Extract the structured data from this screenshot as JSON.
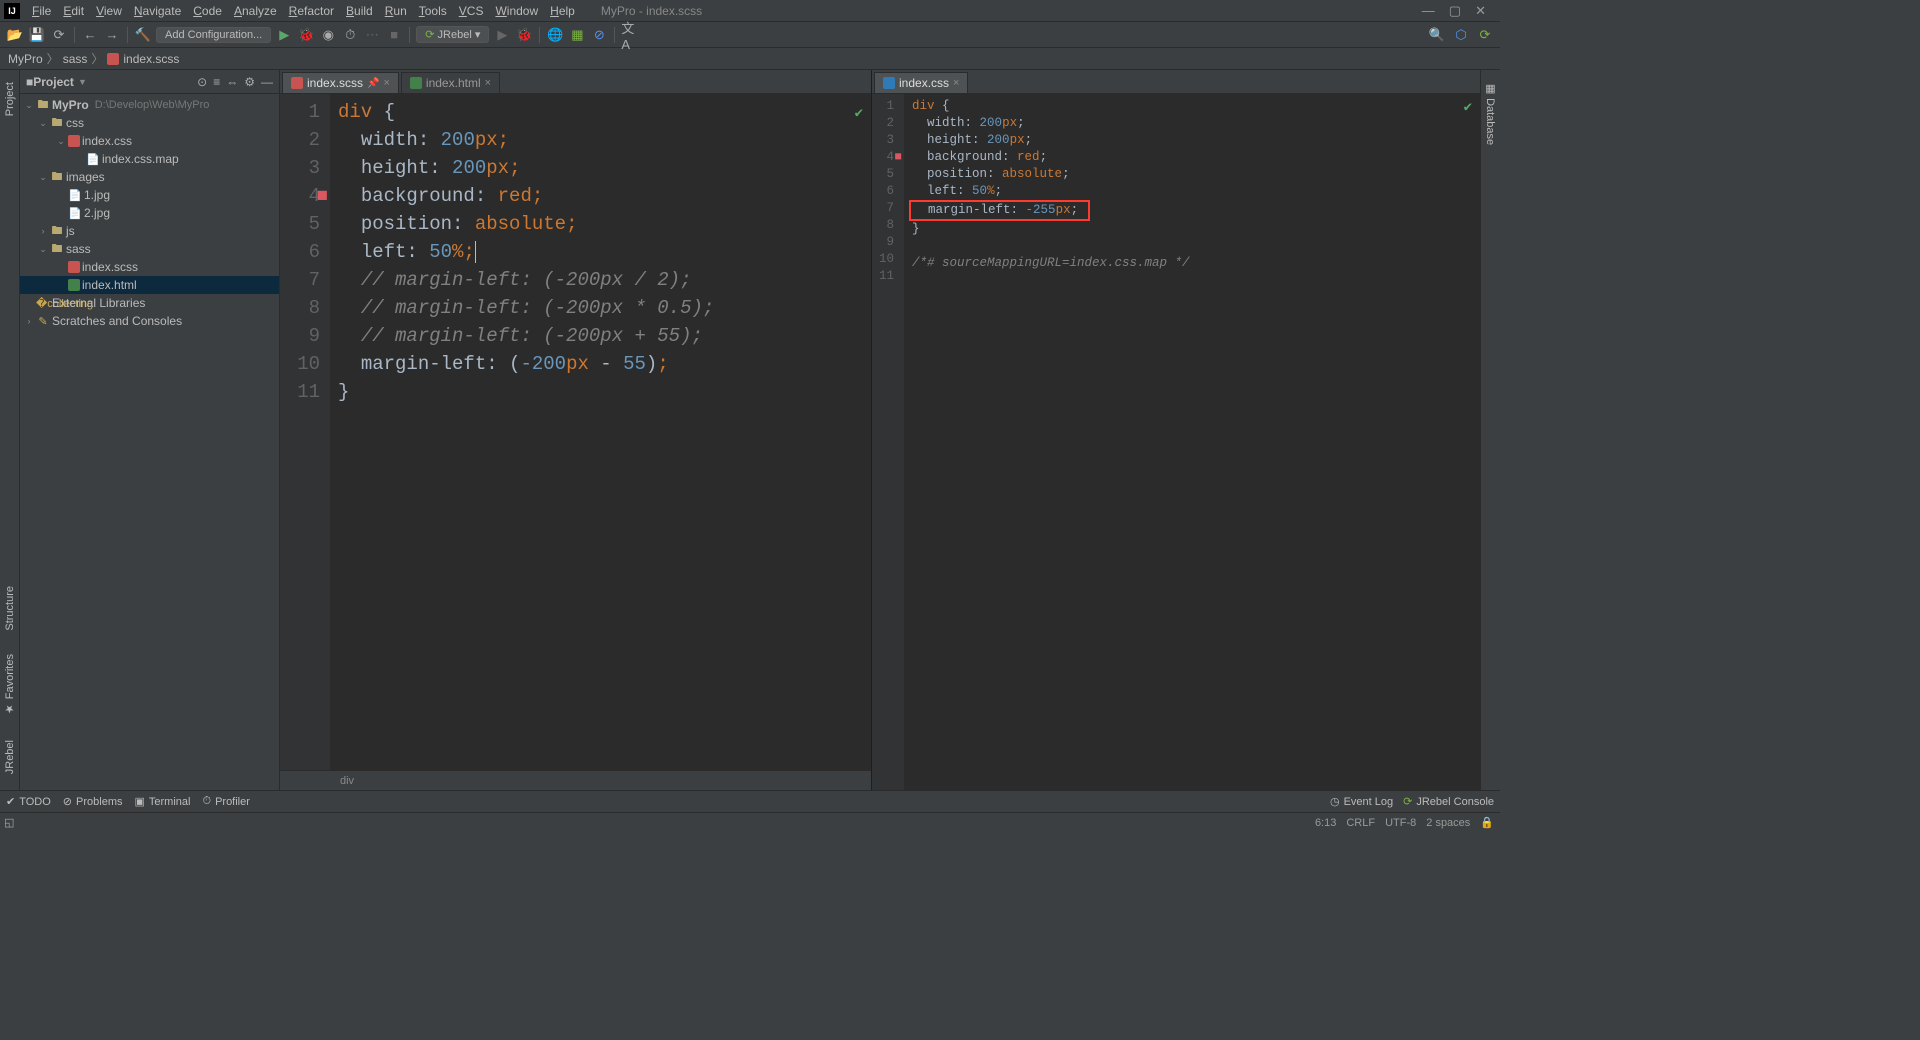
{
  "menu": {
    "items": [
      "File",
      "Edit",
      "View",
      "Navigate",
      "Code",
      "Analyze",
      "Refactor",
      "Build",
      "Run",
      "Tools",
      "VCS",
      "Window",
      "Help"
    ],
    "title": "MyPro - index.scss"
  },
  "winbtns": [
    "—",
    "▢",
    "✕"
  ],
  "toolbar": {
    "add_config": "Add Configuration...",
    "jrebel": "JRebel"
  },
  "crumbs": [
    "MyPro",
    "sass",
    "index.scss"
  ],
  "sidebar": {
    "title": "Project",
    "tree": [
      {
        "depth": 0,
        "expand": "v",
        "icon": "folder",
        "name": "MyPro",
        "path": "D:\\Develop\\Web\\MyPro",
        "bold": true
      },
      {
        "depth": 1,
        "expand": "v",
        "icon": "folder",
        "name": "css"
      },
      {
        "depth": 2,
        "expand": "v",
        "icon": "scss",
        "name": "index.css"
      },
      {
        "depth": 3,
        "expand": "",
        "icon": "file",
        "name": "index.css.map"
      },
      {
        "depth": 1,
        "expand": "v",
        "icon": "folder",
        "name": "images"
      },
      {
        "depth": 2,
        "expand": "",
        "icon": "file",
        "name": "1.jpg"
      },
      {
        "depth": 2,
        "expand": "",
        "icon": "file",
        "name": "2.jpg"
      },
      {
        "depth": 1,
        "expand": ">",
        "icon": "folder",
        "name": "js"
      },
      {
        "depth": 1,
        "expand": "v",
        "icon": "folder",
        "name": "sass"
      },
      {
        "depth": 2,
        "expand": "",
        "icon": "scss",
        "name": "index.scss"
      },
      {
        "depth": 2,
        "expand": "",
        "icon": "html",
        "name": "index.html",
        "sel": true
      },
      {
        "depth": 0,
        "expand": "",
        "icon": "lib",
        "name": "External Libraries"
      },
      {
        "depth": 0,
        "expand": ">",
        "icon": "scratch",
        "name": "Scratches and Consoles"
      }
    ]
  },
  "leftTabs": [
    {
      "name": "index.scss",
      "type": "scss",
      "active": true,
      "pin": true
    },
    {
      "name": "index.html",
      "type": "html"
    }
  ],
  "rightTabs": [
    {
      "name": "index.css",
      "type": "css",
      "active": true
    }
  ],
  "leftCode": {
    "lines": [
      {
        "n": 1,
        "html": "<span class='tag'>div </span><span>{</span>"
      },
      {
        "n": 2,
        "html": "  <span class='prop'>width</span>: <span class='num'>200</span><span class='val'>px</span><span class='punc'>;</span>"
      },
      {
        "n": 3,
        "html": "  <span class='prop'>height</span>: <span class='num'>200</span><span class='val'>px</span><span class='punc'>;</span>"
      },
      {
        "n": 4,
        "bp": true,
        "html": "  <span class='prop'>background</span>: <span class='val'>red</span><span class='punc'>;</span>"
      },
      {
        "n": 5,
        "html": "  <span class='prop'>position</span>: <span class='val'>absolute</span><span class='punc'>;</span>"
      },
      {
        "n": 6,
        "html": "  <span class='prop'>left</span>: <span class='num'>50</span><span class='val'>%</span><span class='punc'>;</span><span class='cursor'></span>"
      },
      {
        "n": 7,
        "html": "  <span class='cmt'>// margin-left: (-200px / 2);</span>"
      },
      {
        "n": 8,
        "html": "  <span class='cmt'>// margin-left: (-200px * 0.5);</span>"
      },
      {
        "n": 9,
        "html": "  <span class='cmt'>// margin-left: (-200px + 55);</span>"
      },
      {
        "n": 10,
        "html": "  <span class='prop'>margin-left</span>: (<span class='num'>-200</span><span class='val'>px</span> - <span class='num'>55</span>)<span class='punc'>;</span>"
      },
      {
        "n": 11,
        "html": "<span>}</span>"
      }
    ],
    "context": "div"
  },
  "rightCode": {
    "lines": [
      {
        "n": 1,
        "html": "<span class='tag'>div </span>{"
      },
      {
        "n": 2,
        "html": "  <span class='prop'>width</span>: <span class='num'>200</span><span class='val'>px</span>;"
      },
      {
        "n": 3,
        "html": "  <span class='prop'>height</span>: <span class='num'>200</span><span class='val'>px</span>;"
      },
      {
        "n": 4,
        "bp": true,
        "html": "  <span class='prop'>background</span>: <span class='val'>red</span>;"
      },
      {
        "n": 5,
        "html": "  <span class='prop'>position</span>: <span class='val'>absolute</span>;"
      },
      {
        "n": 6,
        "html": "  <span class='prop'>left</span>: <span class='num'>50</span><span class='val'>%</span>;"
      },
      {
        "n": 7,
        "html": "<span class='highlight'>  <span class='prop'>margin-left</span>: <span class='num'>-255</span><span class='val'>px</span>; </span>"
      },
      {
        "n": 8,
        "html": "}"
      },
      {
        "n": 9,
        "html": ""
      },
      {
        "n": 10,
        "html": "<span class='cmt'>/*# sourceMappingURL=index.css.map */</span>"
      },
      {
        "n": 11,
        "html": ""
      }
    ]
  },
  "leftStrip": {
    "top": "Project",
    "bottom": [
      "Structure",
      "Favorites",
      "JRebel"
    ]
  },
  "rightStrip": [
    "Database"
  ],
  "bottomTools": [
    "TODO",
    "Problems",
    "Terminal",
    "Profiler"
  ],
  "bottomRight": [
    "Event Log",
    "JRebel Console"
  ],
  "status": {
    "pos": "6:13",
    "le": "CRLF",
    "enc": "UTF-8",
    "indent": "2 spaces"
  }
}
